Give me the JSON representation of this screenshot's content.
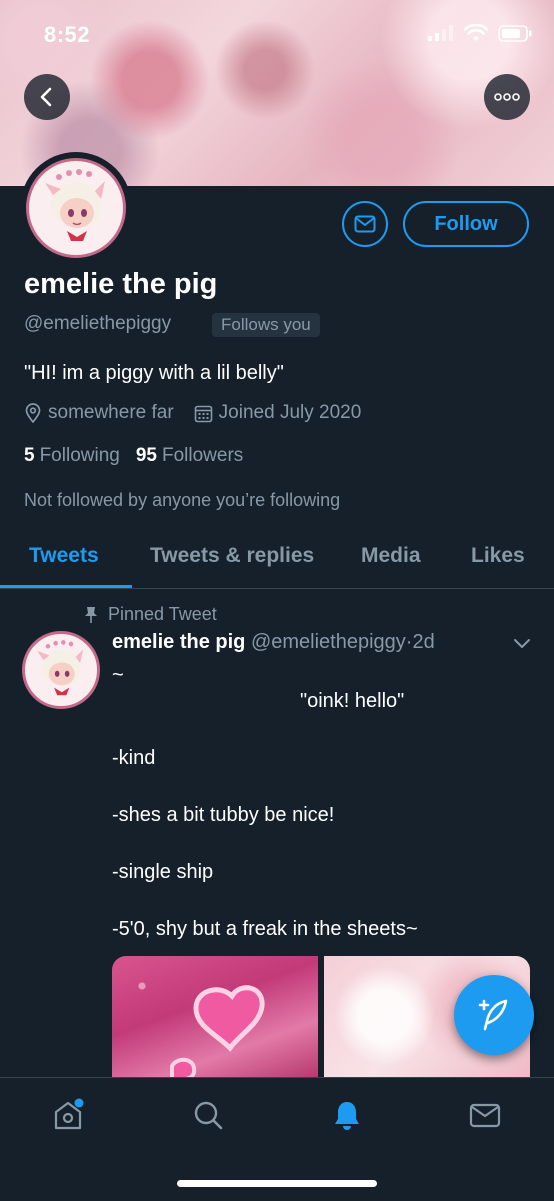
{
  "status_bar": {
    "time": "8:52"
  },
  "header": {
    "back_icon": "back-arrow-icon",
    "more_icon": "more-horizontal-icon"
  },
  "profile": {
    "name": "emelie the pig",
    "handle": "@emeliethepiggy",
    "follows_you": "Follows you",
    "bio": "\"HI! im a piggy with a lil belly\"",
    "location": "somewhere far",
    "joined": "Joined July 2020",
    "following_count": "5",
    "following_label": "Following",
    "followers_count": "95",
    "followers_label": "Followers",
    "not_followed": "Not followed by anyone you’re following",
    "follow_button": "Follow",
    "message_icon": "envelope-icon"
  },
  "tabs": [
    {
      "label": "Tweets",
      "active": true
    },
    {
      "label": "Tweets & replies",
      "active": false
    },
    {
      "label": "Media",
      "active": false
    },
    {
      "label": "Likes",
      "active": false
    }
  ],
  "tweet": {
    "pinned_label": "Pinned Tweet",
    "author_name": "emelie the pig",
    "author_handle": "@emeliethepiggy",
    "separator": "·",
    "time": "2d",
    "lines": [
      "~",
      "\"oink! hello\"",
      "-kind",
      "-shes a bit tubby be nice!",
      "-single ship",
      "-5'0, shy but a freak in the sheets~"
    ]
  },
  "bottom_nav": [
    {
      "name": "home-icon",
      "active": false,
      "badge": true
    },
    {
      "name": "search-icon",
      "active": false,
      "badge": false
    },
    {
      "name": "notifications-bell-icon",
      "active": true,
      "badge": false
    },
    {
      "name": "messages-envelope-icon",
      "active": false,
      "badge": false
    }
  ],
  "colors": {
    "accent": "#1d9bf0",
    "background": "#15202b",
    "secondary_text": "#8899a6",
    "divider": "#38444d"
  }
}
